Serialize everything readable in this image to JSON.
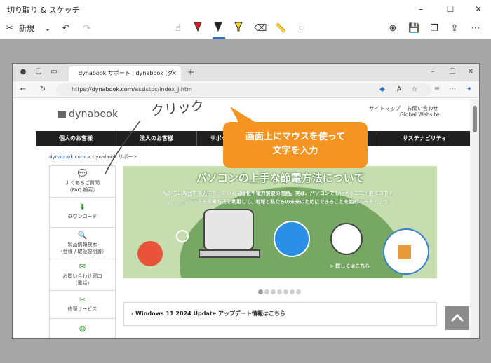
{
  "app": {
    "title": "切り取り & スケッチ",
    "new_label": "新規",
    "window_controls": {
      "minimize": "–",
      "maximize": "☐",
      "close": "✕"
    }
  },
  "browser": {
    "tab_title": "dynabook サポート | dynabook (ダ",
    "tab_close": "×",
    "new_tab": "+",
    "url_prefix": "https://",
    "url_host": "dynabook.com",
    "url_path": "/assistpc/index_j.htm"
  },
  "site": {
    "logo": "dynabook",
    "sitemap": "サイトマップ",
    "contact": "お問い合わせ",
    "global": "Global Website",
    "nav": [
      "個人のお客様",
      "法人のお客様",
      "サポート",
      "",
      "",
      "サステナビリティ"
    ],
    "breadcrumb_link": "dynabook.com",
    "breadcrumb_sep": " > ",
    "breadcrumb_current": "dynabook サポート",
    "sidebar": [
      {
        "line1": "よくあるご質問",
        "line2": "（FAQ 検索）",
        "icon": "qa-icon"
      },
      {
        "line1": "ダウンロード",
        "line2": "",
        "icon": "download-icon"
      },
      {
        "line1": "製品情報検索",
        "line2": "（仕様 / 取扱説明書）",
        "icon": "search-icon"
      },
      {
        "line1": "お問い合わせ窓口",
        "line2": "（電話）",
        "icon": "mail-icon"
      },
      {
        "line1": "修理サービス",
        "line2": "",
        "icon": "tools-icon"
      }
    ],
    "banner": {
      "headline": "パソコンの上手な節電方法について",
      "sub1": "私たちの周囲で身近になっている温暖化や電力需要の問題。実は、パソコンでも行えるエコがあるのです。",
      "sub2": "パソコンでできる節電方法を利用して、地球と私たちの未来のためにできることを始めてみましょう。",
      "more": "> 詳しくはこちら"
    },
    "news_item": "Windows 11 2024 Update アップデート情報はこちら"
  },
  "annotations": {
    "handwriting": "クリック",
    "callout_line1": "画面上にマウスを使って",
    "callout_line2": "文字を入力"
  },
  "colors": {
    "callout": "#f39423",
    "nav_bg": "#1f1f1f",
    "accent_underline": "#2c6fd3"
  }
}
